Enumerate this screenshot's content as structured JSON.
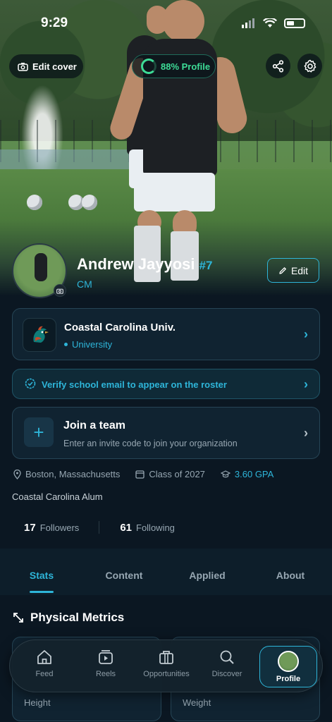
{
  "status_bar": {
    "time": "9:29"
  },
  "cover": {
    "edit_cover_label": "Edit cover",
    "profile_progress_label": "88% Profile",
    "profile_progress_value": 0.88
  },
  "profile": {
    "name": "Andrew Jayyosi",
    "jersey": "#7",
    "position": "CM",
    "edit_label": "Edit"
  },
  "school": {
    "name": "Coastal Carolina Univ.",
    "type": "University"
  },
  "verify": {
    "text": "Verify school email to appear on the roster"
  },
  "team": {
    "title": "Join a team",
    "subtitle": "Enter an invite code to join your organization"
  },
  "info": {
    "location": "Boston, Massachusetts",
    "class_year": "Class of 2027",
    "gpa": "3.60 GPA"
  },
  "bio": "Coastal Carolina Alum",
  "social": {
    "followers_count": "17",
    "followers_label": "Followers",
    "following_count": "61",
    "following_label": "Following"
  },
  "tabs": [
    {
      "label": "Stats",
      "active": true
    },
    {
      "label": "Content",
      "active": false
    },
    {
      "label": "Applied",
      "active": false
    },
    {
      "label": "About",
      "active": false
    }
  ],
  "section": {
    "title": "Physical Metrics"
  },
  "metrics": [
    {
      "label": "Height"
    },
    {
      "label": "Weight"
    }
  ],
  "nav": {
    "feed": "Feed",
    "reels": "Reels",
    "opportunities": "Opportunities",
    "discover": "Discover",
    "profile": "Profile"
  },
  "colors": {
    "accent": "#2eb5d9",
    "progress": "#3ddc97",
    "background": "#0b1722"
  },
  "icons": [
    "camera-icon",
    "share-icon",
    "gear-icon",
    "pencil-icon",
    "chevron-right-icon",
    "verified-badge-icon",
    "plus-icon",
    "location-pin-icon",
    "calendar-icon",
    "graduation-cap-icon",
    "expand-arrows-icon",
    "home-icon",
    "reels-icon",
    "briefcase-icon",
    "search-icon"
  ]
}
